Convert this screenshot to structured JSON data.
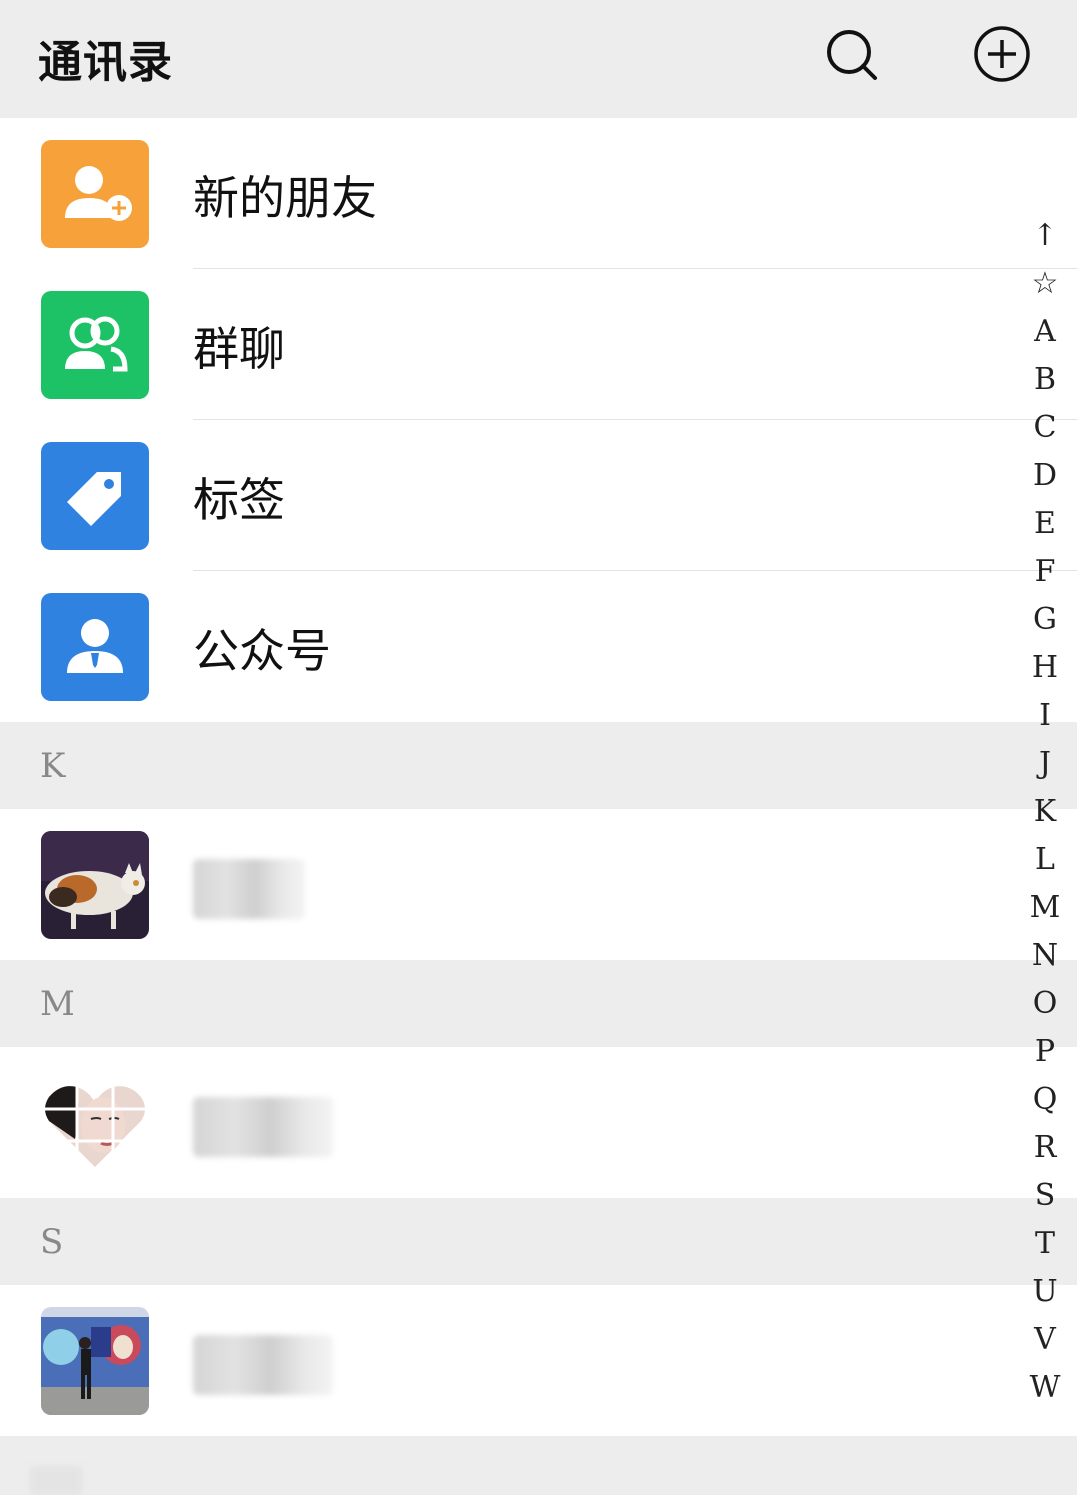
{
  "header": {
    "title": "通讯录",
    "search_icon": "search-icon",
    "add_icon": "plus-circle-icon"
  },
  "functions": [
    {
      "label": "新的朋友",
      "icon": "add-friend-icon",
      "color": "#f7a13b"
    },
    {
      "label": "群聊",
      "icon": "group-chat-icon",
      "color": "#1ec266"
    },
    {
      "label": "标签",
      "icon": "tag-icon",
      "color": "#2f82e0"
    },
    {
      "label": "公众号",
      "icon": "official-account-icon",
      "color": "#2f82e0"
    }
  ],
  "sections": [
    {
      "letter": "K",
      "contacts": [
        {
          "avatar": "cat-avatar"
        }
      ]
    },
    {
      "letter": "M",
      "contacts": [
        {
          "avatar": "heart-portrait-avatar"
        }
      ]
    },
    {
      "letter": "S",
      "contacts": [
        {
          "avatar": "graffiti-wall-avatar"
        }
      ]
    }
  ],
  "index_bar": [
    "↑",
    "☆",
    "A",
    "B",
    "C",
    "D",
    "E",
    "F",
    "G",
    "H",
    "I",
    "J",
    "K",
    "L",
    "M",
    "N",
    "O",
    "P",
    "Q",
    "R",
    "S",
    "T",
    "U",
    "V",
    "W"
  ]
}
